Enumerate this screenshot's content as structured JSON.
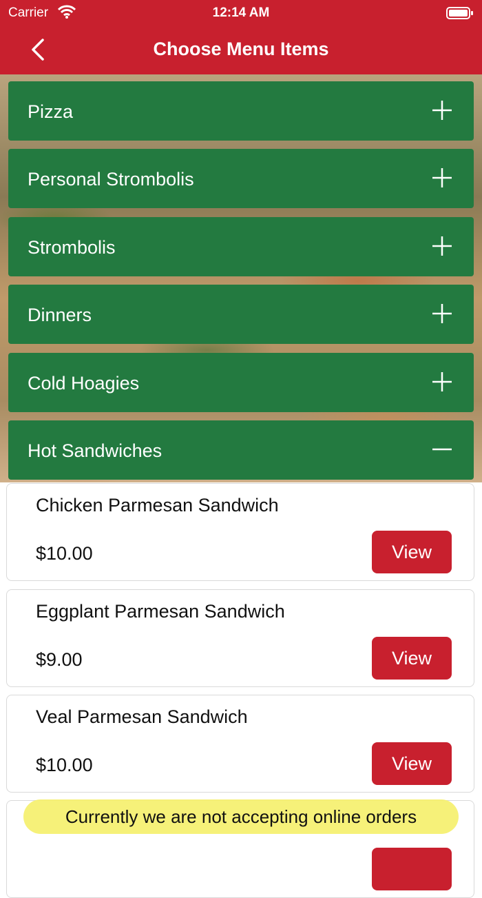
{
  "status_bar": {
    "carrier": "Carrier",
    "time": "12:14 AM"
  },
  "nav": {
    "title": "Choose Menu Items"
  },
  "categories": [
    {
      "label": "Pizza",
      "expanded": false
    },
    {
      "label": "Personal Strombolis",
      "expanded": false
    },
    {
      "label": "Strombolis",
      "expanded": false
    },
    {
      "label": "Dinners",
      "expanded": false
    },
    {
      "label": "Cold Hoagies",
      "expanded": false
    },
    {
      "label": "Hot Sandwiches",
      "expanded": true
    }
  ],
  "items": [
    {
      "name": "Chicken Parmesan Sandwich",
      "price": "$10.00",
      "button": "View"
    },
    {
      "name": "Eggplant Parmesan Sandwich",
      "price": "$9.00",
      "button": "View"
    },
    {
      "name": "Veal Parmesan Sandwich",
      "price": "$10.00",
      "button": "View"
    },
    {
      "name": "",
      "price": "",
      "button": ""
    }
  ],
  "toast": {
    "message": "Currently we are not accepting online orders"
  },
  "colors": {
    "brand_red": "#c8202e",
    "category_green": "#237a40",
    "toast_yellow": "#f5f06e"
  }
}
